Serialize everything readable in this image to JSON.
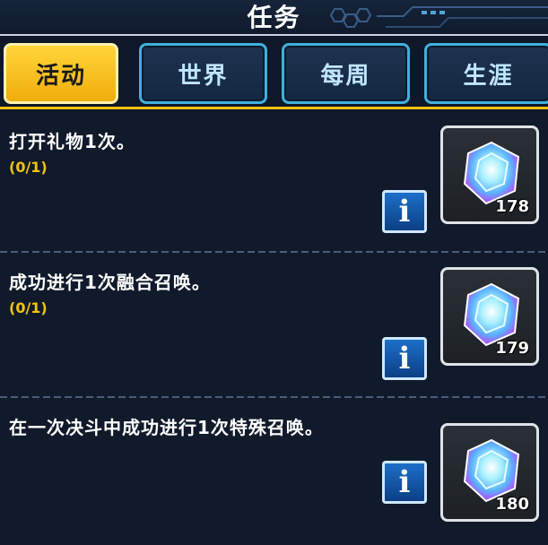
{
  "header": {
    "title": "任务"
  },
  "tabs": [
    {
      "label": "活动",
      "active": true
    },
    {
      "label": "世界",
      "active": false
    },
    {
      "label": "每周",
      "active": false
    },
    {
      "label": "生涯",
      "active": false
    }
  ],
  "missions": [
    {
      "text": "打开礼物1次。",
      "progress": "(0/1)",
      "info_label": "i",
      "reward_count": "178"
    },
    {
      "text": "成功进行1次融合召唤。",
      "progress": "(0/1)",
      "info_label": "i",
      "reward_count": "179"
    },
    {
      "text": "在一次决斗中成功进行1次特殊召唤。",
      "progress": "",
      "info_label": "i",
      "reward_count": "180"
    }
  ],
  "colors": {
    "accent_gold": "#f3c20f",
    "tab_border": "#3fb0dc",
    "progress": "#f0c40e"
  }
}
